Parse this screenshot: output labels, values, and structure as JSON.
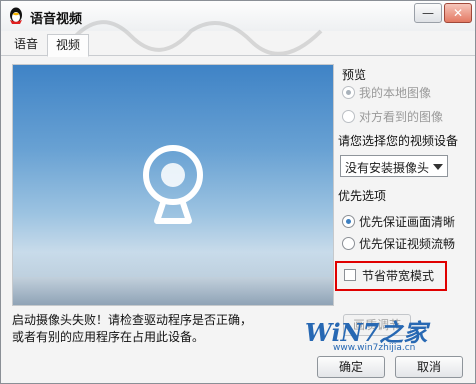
{
  "window": {
    "title": "语音视频"
  },
  "titlebar_buttons": {
    "minimize": "—",
    "close": "✕"
  },
  "tabs": [
    {
      "label": "语音"
    },
    {
      "label": "视频"
    }
  ],
  "preview": {
    "label": "预览",
    "options": [
      {
        "label": "我的本地图像",
        "selected": true,
        "enabled": false
      },
      {
        "label": "对方看到的图像",
        "selected": false,
        "enabled": false
      }
    ]
  },
  "device": {
    "label": "请您选择您的视频设备",
    "selected": "没有安装摄像头"
  },
  "priority": {
    "label": "优先选项",
    "options": [
      {
        "label": "优先保证画面清晰",
        "selected": true
      },
      {
        "label": "优先保证视频流畅",
        "selected": false
      }
    ]
  },
  "bandwidth": {
    "label": "节省带宽模式",
    "checked": false
  },
  "status": {
    "message": "启动摄像头失败！请检查驱动程序是否正确，或者有别的应用程序在占用此设备。"
  },
  "buttons": {
    "advanced": "画质调节",
    "ok": "确定",
    "cancel": "取消"
  },
  "watermark": {
    "logo": "WiN7之家",
    "url": "www.win7zhijia.cn"
  },
  "colors": {
    "accent": "#3c7fc1",
    "highlight_box": "#e00000",
    "watermark": "#2768b3"
  }
}
